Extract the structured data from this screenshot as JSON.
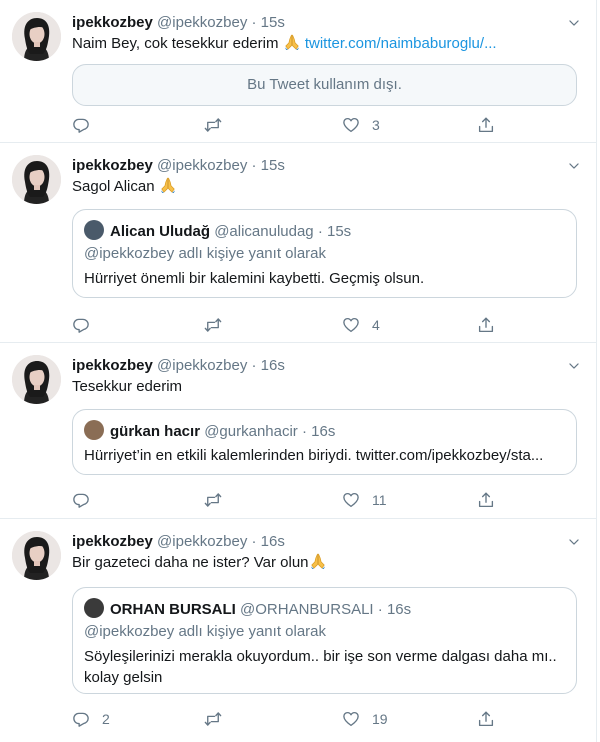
{
  "tweets": [
    {
      "name": "ipekkozbey",
      "handle": "@ipekkozbey",
      "time": "15s",
      "text": "Naim Bey, cok tesekkur ederim",
      "link": "twitter.com/naimbaburoglu/...",
      "unavailable": "Bu Tweet kullanım dışı.",
      "reply_count": "",
      "retweet_count": "",
      "like_count": "3"
    },
    {
      "name": "ipekkozbey",
      "handle": "@ipekkozbey",
      "time": "15s",
      "text": "Sagol Alican",
      "quote": {
        "name": "Alican Uludağ",
        "handle": "@alicanuludag",
        "time": "15s",
        "reply_context": "@ipekkozbey adlı kişiye yanıt olarak",
        "text": "Hürriyet önemli bir kalemini kaybetti. Geçmiş olsun."
      },
      "reply_count": "",
      "retweet_count": "",
      "like_count": "4"
    },
    {
      "name": "ipekkozbey",
      "handle": "@ipekkozbey",
      "time": "16s",
      "text": "Tesekkur ederim",
      "quote": {
        "name": "gürkan hacır",
        "handle": "@gurkanhacir",
        "time": "16s",
        "text": "Hürriyet’in en etkili kalemlerinden biriydi. twitter.com/ipekkozbey/sta..."
      },
      "reply_count": "",
      "retweet_count": "",
      "like_count": "11"
    },
    {
      "name": "ipekkozbey",
      "handle": "@ipekkozbey",
      "time": "16s",
      "text": "Bir gazeteci daha ne ister? Var olun",
      "quote": {
        "name": "ORHAN BURSALI",
        "handle": "@ORHANBURSALI",
        "time": "16s",
        "reply_context": "@ipekkozbey adlı kişiye yanıt olarak",
        "text_line1": "Söyleşilerinizi merakla okuyordum.. bir işe son verme dalgası daha mı..",
        "text_line2": "kolay gelsin"
      },
      "reply_count": "2",
      "retweet_count": "",
      "like_count": "19"
    }
  ],
  "separator": "·",
  "icons": {
    "avatar": "profile-photo",
    "caret": "chevron-down-icon",
    "reply": "reply-icon",
    "retweet": "retweet-icon",
    "like": "heart-icon",
    "share": "share-icon",
    "emoji": "folded-hands-emoji"
  },
  "colors": {
    "link": "#1b95e0",
    "muted": "#657786",
    "border": "#e6ecf0"
  }
}
